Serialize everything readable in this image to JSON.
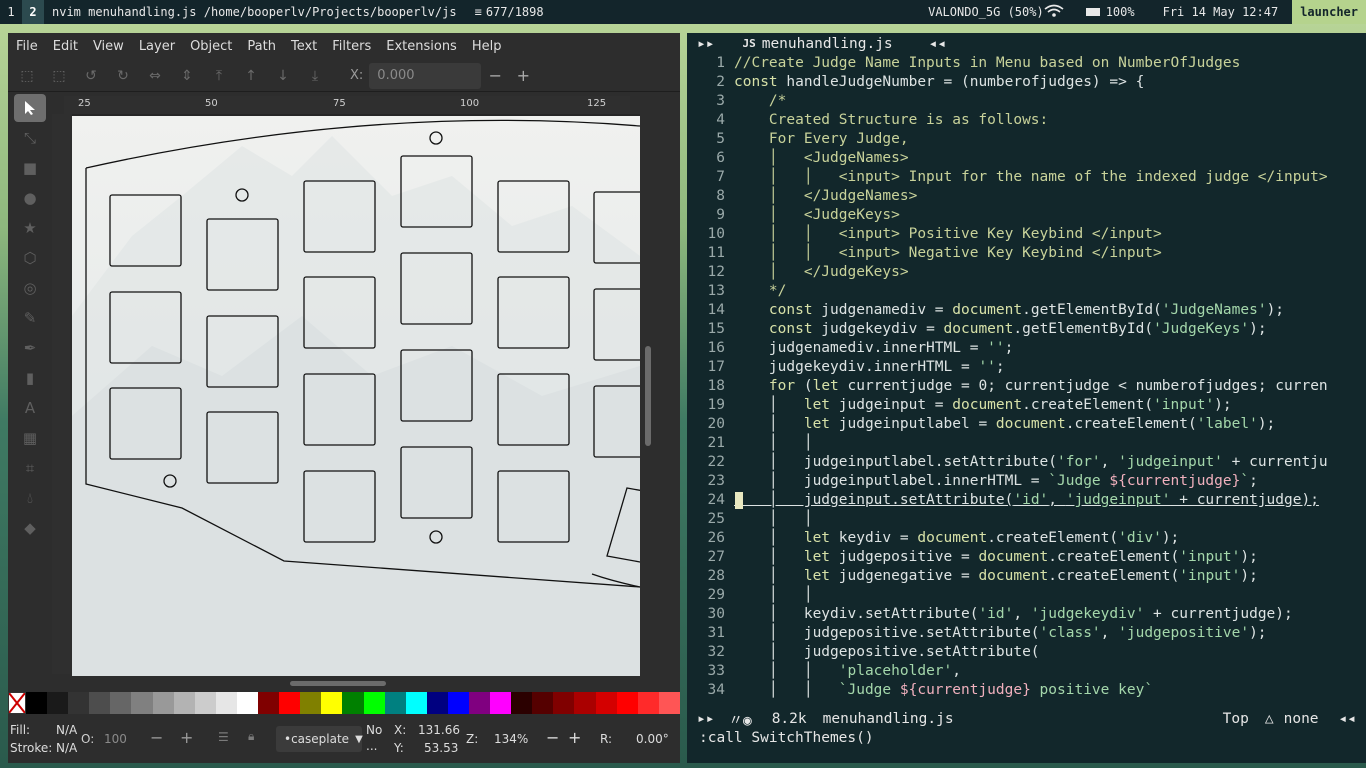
{
  "topbar": {
    "workspaces": [
      "1",
      "2"
    ],
    "window_title": "nvim menuhandling.js /home/booperlv/Projects/booperlv/js",
    "position": "677/1898",
    "wifi": "VALONDO_5G (50%)",
    "battery": "100%",
    "datetime": "Fri 14 May 12:47",
    "launcher": "launcher"
  },
  "inkscape": {
    "menu": [
      "File",
      "Edit",
      "View",
      "Layer",
      "Object",
      "Path",
      "Text",
      "Filters",
      "Extensions",
      "Help"
    ],
    "x_label": "X:",
    "x_value": "0.000",
    "ruler_ticks": [
      "25",
      "50",
      "75",
      "100",
      "125"
    ],
    "status": {
      "fill_label": "Fill:",
      "fill_value": "N/A",
      "stroke_label": "Stroke:",
      "stroke_value": "N/A",
      "opacity_label": "O:",
      "opacity_value": "100",
      "layer": "•caseplate",
      "no_label": "No",
      "no_label2": "...",
      "x_label": "X:",
      "x_value": "131.66",
      "y_label": "Y:",
      "y_value": "53.53",
      "zoom_label": "Z:",
      "zoom_value": "134%",
      "rotate_label": "R:",
      "rotate_value": "0.00°"
    },
    "palette": [
      "#000000",
      "#1a1a1a",
      "#333333",
      "#4d4d4d",
      "#666666",
      "#808080",
      "#999999",
      "#b3b3b3",
      "#cccccc",
      "#e6e6e6",
      "#ffffff",
      "#800000",
      "#ff0000",
      "#808000",
      "#ffff00",
      "#008000",
      "#00ff00",
      "#008080",
      "#00ffff",
      "#000080",
      "#0000ff",
      "#800080",
      "#ff00ff",
      "#2b0000",
      "#550000",
      "#800000",
      "#aa0000",
      "#d40000",
      "#ff0000",
      "#ff2a2a",
      "#ff5555"
    ]
  },
  "nvim": {
    "tab_left": "▸▸",
    "tab_icon": "JS",
    "tab_name": "menuhandling.js",
    "tab_close": "◂◂",
    "lines": [
      {
        "n": "1",
        "segs": [
          [
            "cmt",
            "//Create Judge Name Inputs in Menu based on NumberOfJudges"
          ]
        ]
      },
      {
        "n": "2",
        "segs": [
          [
            "kw",
            "const"
          ],
          [
            "",
            " handleJudgeNumber = (numberofjudges) => {"
          ]
        ]
      },
      {
        "n": "3",
        "segs": [
          [
            "cmt",
            "    /*"
          ]
        ]
      },
      {
        "n": "4",
        "segs": [
          [
            "cmt",
            "    Created Structure is as follows:"
          ]
        ]
      },
      {
        "n": "5",
        "segs": [
          [
            "cmt",
            "    For Every Judge,"
          ]
        ]
      },
      {
        "n": "6",
        "segs": [
          [
            "cmt",
            "    │   <JudgeNames>"
          ]
        ]
      },
      {
        "n": "7",
        "segs": [
          [
            "cmt",
            "    │   │   <input> Input for the name of the indexed judge </input>"
          ]
        ]
      },
      {
        "n": "8",
        "segs": [
          [
            "cmt",
            "    │   </JudgeNames>"
          ]
        ]
      },
      {
        "n": "9",
        "segs": [
          [
            "cmt",
            "    │   <JudgeKeys>"
          ]
        ]
      },
      {
        "n": "10",
        "segs": [
          [
            "cmt",
            "    │   │   <input> Positive Key Keybind </input>"
          ]
        ]
      },
      {
        "n": "11",
        "segs": [
          [
            "cmt",
            "    │   │   <input> Negative Key Keybind </input>"
          ]
        ]
      },
      {
        "n": "12",
        "segs": [
          [
            "cmt",
            "    │   </JudgeKeys>"
          ]
        ]
      },
      {
        "n": "13",
        "segs": [
          [
            "cmt",
            "    */"
          ]
        ]
      },
      {
        "n": "14",
        "segs": [
          [
            "",
            "    "
          ],
          [
            "kw",
            "const"
          ],
          [
            "",
            " judgenamediv = "
          ],
          [
            "kw",
            "document"
          ],
          [
            "",
            ".getElementById("
          ],
          [
            "str",
            "'JudgeNames'"
          ],
          [
            "",
            ");"
          ]
        ]
      },
      {
        "n": "15",
        "segs": [
          [
            "",
            "    "
          ],
          [
            "kw",
            "const"
          ],
          [
            "",
            " judgekeydiv = "
          ],
          [
            "kw",
            "document"
          ],
          [
            "",
            ".getElementById("
          ],
          [
            "str",
            "'JudgeKeys'"
          ],
          [
            "",
            ");"
          ]
        ]
      },
      {
        "n": "16",
        "segs": [
          [
            "",
            "    judgenamediv.innerHTML = "
          ],
          [
            "str",
            "''"
          ],
          [
            "",
            ";"
          ]
        ]
      },
      {
        "n": "17",
        "segs": [
          [
            "",
            "    judgekeydiv.innerHTML = "
          ],
          [
            "str",
            "''"
          ],
          [
            "",
            ";"
          ]
        ]
      },
      {
        "n": "18",
        "segs": [
          [
            "",
            "    "
          ],
          [
            "kw",
            "for"
          ],
          [
            "",
            " ("
          ],
          [
            "kw",
            "let"
          ],
          [
            "",
            " currentjudge = 0; currentjudge < numberofjudges; curren"
          ]
        ]
      },
      {
        "n": "19",
        "segs": [
          [
            "",
            "    │   "
          ],
          [
            "kw",
            "let"
          ],
          [
            "",
            " judgeinput = "
          ],
          [
            "kw",
            "document"
          ],
          [
            "",
            ".createElement("
          ],
          [
            "str",
            "'input'"
          ],
          [
            "",
            ");"
          ]
        ]
      },
      {
        "n": "20",
        "segs": [
          [
            "",
            "    │   "
          ],
          [
            "kw",
            "let"
          ],
          [
            "",
            " judgeinputlabel = "
          ],
          [
            "kw",
            "document"
          ],
          [
            "",
            ".createElement("
          ],
          [
            "str",
            "'label'"
          ],
          [
            "",
            ");"
          ]
        ]
      },
      {
        "n": "21",
        "segs": [
          [
            "",
            "    │   │"
          ]
        ]
      },
      {
        "n": "22",
        "segs": [
          [
            "",
            "    │   judgeinputlabel.setAttribute("
          ],
          [
            "str",
            "'for'"
          ],
          [
            "",
            ", "
          ],
          [
            "str",
            "'judgeinput'"
          ],
          [
            "",
            " + currentju"
          ]
        ]
      },
      {
        "n": "23",
        "segs": [
          [
            "",
            "    │   judgeinputlabel.innerHTML = "
          ],
          [
            "str",
            "`Judge "
          ],
          [
            "tmpl",
            "${currentjudge}"
          ],
          [
            "str",
            "`"
          ],
          [
            "",
            ";"
          ]
        ]
      },
      {
        "n": "24",
        "segs": [
          [
            "",
            "    │   judgeinput.setAttribute("
          ],
          [
            "str",
            "'id'"
          ],
          [
            "",
            ", "
          ],
          [
            "str",
            "'judgeinput'"
          ],
          [
            "",
            " + currentjudge);"
          ]
        ],
        "cursor": true
      },
      {
        "n": "25",
        "segs": [
          [
            "",
            "    │   │"
          ]
        ]
      },
      {
        "n": "26",
        "segs": [
          [
            "",
            "    │   "
          ],
          [
            "kw",
            "let"
          ],
          [
            "",
            " keydiv = "
          ],
          [
            "kw",
            "document"
          ],
          [
            "",
            ".createElement("
          ],
          [
            "str",
            "'div'"
          ],
          [
            "",
            ");"
          ]
        ]
      },
      {
        "n": "27",
        "segs": [
          [
            "",
            "    │   "
          ],
          [
            "kw",
            "let"
          ],
          [
            "",
            " judgepositive = "
          ],
          [
            "kw",
            "document"
          ],
          [
            "",
            ".createElement("
          ],
          [
            "str",
            "'input'"
          ],
          [
            "",
            ");"
          ]
        ]
      },
      {
        "n": "28",
        "segs": [
          [
            "",
            "    │   "
          ],
          [
            "kw",
            "let"
          ],
          [
            "",
            " judgenegative = "
          ],
          [
            "kw",
            "document"
          ],
          [
            "",
            ".createElement("
          ],
          [
            "str",
            "'input'"
          ],
          [
            "",
            ");"
          ]
        ]
      },
      {
        "n": "29",
        "segs": [
          [
            "",
            "    │   │"
          ]
        ]
      },
      {
        "n": "30",
        "segs": [
          [
            "",
            "    │   keydiv.setAttribute("
          ],
          [
            "str",
            "'id'"
          ],
          [
            "",
            ", "
          ],
          [
            "str",
            "'judgekeydiv'"
          ],
          [
            "",
            " + currentjudge);"
          ]
        ]
      },
      {
        "n": "31",
        "segs": [
          [
            "",
            "    │   judgepositive.setAttribute("
          ],
          [
            "str",
            "'class'"
          ],
          [
            "",
            ", "
          ],
          [
            "str",
            "'judgepositive'"
          ],
          [
            "",
            ");"
          ]
        ]
      },
      {
        "n": "32",
        "segs": [
          [
            "",
            "    │   judgepositive.setAttribute("
          ]
        ]
      },
      {
        "n": "33",
        "segs": [
          [
            "",
            "    │   │   "
          ],
          [
            "str",
            "'placeholder'"
          ],
          [
            "",
            ","
          ]
        ]
      },
      {
        "n": "34",
        "segs": [
          [
            "",
            "    │   │   "
          ],
          [
            "str",
            "`Judge "
          ],
          [
            "tmpl",
            "${currentjudge}"
          ],
          [
            "str",
            " positive key`"
          ]
        ]
      }
    ],
    "status": {
      "mode_icon": "▸▸",
      "icons": "〃◉",
      "size": "8.2k",
      "file": "menuhandling.js",
      "position": "Top",
      "os_icon": "△",
      "fileformat": "none",
      "end": "◂◂"
    },
    "cmdline": ":call SwitchThemes()"
  }
}
